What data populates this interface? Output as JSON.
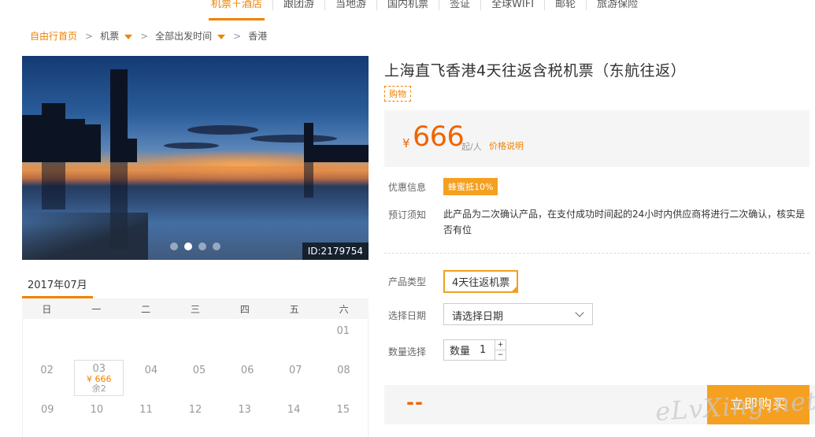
{
  "topnav": {
    "items": [
      "机票＋酒店",
      "跟团游",
      "当地游",
      "国内机票",
      "签证",
      "全球WIFI",
      "邮轮",
      "旅游保险"
    ],
    "active_index": 0
  },
  "breadcrumb": {
    "home": "自由行首页",
    "sep": ">",
    "category": "机票",
    "time": "全部出发时间",
    "dest": "香港"
  },
  "hero": {
    "image_id": "ID:2179754",
    "slide_count": 4,
    "active_slide": 1
  },
  "calendar": {
    "month": "2017年07月",
    "weekdays": [
      "日",
      "一",
      "二",
      "三",
      "四",
      "五",
      "六"
    ],
    "rows": [
      [
        "",
        "",
        "",
        "",
        "",
        "",
        "01"
      ],
      [
        "02",
        "03",
        "04",
        "05",
        "06",
        "07",
        "08"
      ],
      [
        "09",
        "10",
        "11",
        "12",
        "13",
        "14",
        "15"
      ]
    ],
    "selected_day": {
      "date": "03",
      "price": "¥ 666",
      "remaining": "余2"
    }
  },
  "product": {
    "title": "上海直飞香港4天往返含税机票（东航往返）",
    "tag": "购物",
    "price": {
      "currency": "¥",
      "amount": "666",
      "per": "起/人",
      "explain": "价格说明"
    },
    "promo_label": "优惠信息",
    "promo_value": "蜂蜜抵10%",
    "notice_label": "预订须知",
    "notice_text": "此产品为二次确认产品，在支付成功时间起的24小时内供应商将进行二次确认，核实是否有位",
    "type_label": "产品类型",
    "type_value": "4天往返机票",
    "date_label": "选择日期",
    "date_placeholder": "请选择日期",
    "qty_label": "数量选择",
    "qty_inner_label": "数量",
    "qty_value": "1",
    "qty_plus": "+",
    "qty_minus": "−",
    "total_price": "--",
    "buy_label": "立即购买"
  },
  "watermark": "eLvXing.net",
  "colors": {
    "accent": "#f08200",
    "price": "#f06400",
    "button": "#f5a020"
  }
}
